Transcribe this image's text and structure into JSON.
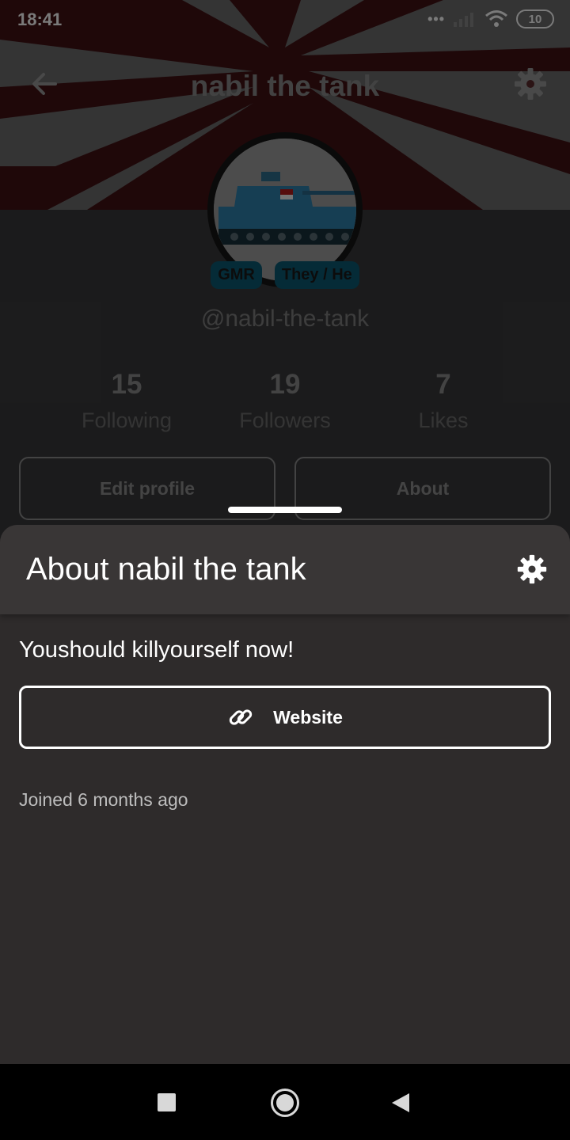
{
  "status_bar": {
    "time": "18:41",
    "signal": "•••",
    "battery": "10"
  },
  "profile": {
    "title": "nabil the tank",
    "handle": "@nabil-the-tank",
    "badges": [
      "GMR",
      "They / He"
    ],
    "stats": [
      {
        "value": "15",
        "label": "Following"
      },
      {
        "value": "19",
        "label": "Followers"
      },
      {
        "value": "7",
        "label": "Likes"
      }
    ],
    "edit_label": "Edit profile",
    "about_label": "About"
  },
  "sheet": {
    "title": "About nabil the tank",
    "bio": "Youshould killyourself now!",
    "website_label": "Website",
    "joined": "Joined 6 months ago"
  },
  "colors": {
    "banner_red": "#4a1317",
    "badge": "#0b5a74",
    "sheet_bg": "#2e2b2b"
  },
  "icons": [
    "back-arrow-icon",
    "gear-icon",
    "link-icon",
    "nav-recents-icon",
    "nav-home-icon",
    "nav-back-icon"
  ]
}
